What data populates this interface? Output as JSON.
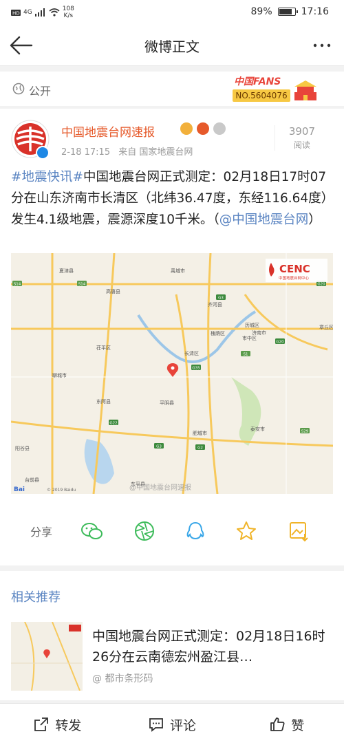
{
  "status": {
    "signal": "4G",
    "speed_value": "108",
    "speed_unit": "K/s",
    "battery": "89%",
    "battery_level": 0.89,
    "time": "17:16"
  },
  "nav": {
    "title": "微博正文"
  },
  "visibility": {
    "label": "公开"
  },
  "fans_badge": {
    "brand": "中国FANS",
    "number": "NO.5604076"
  },
  "post": {
    "author": "中国地震台网速报",
    "timestamp": "2-18 17:15",
    "source": "来自 国家地震台网",
    "read_count": "3907",
    "read_label": "阅读",
    "hashtag": "#地震快讯#",
    "body": "中国地震台网正式测定：02月18日17时07分在山东济南市长清区（北纬36.47度，东经116.64度）发生4.1级地震，震源深度10千米。（",
    "mention": "@中国地震台网",
    "closing": "）"
  },
  "map": {
    "logo": "CENC",
    "logo_sub": "中国地震台网中心",
    "copyright": "© 2019 Baidu",
    "baidu": "Bai",
    "watermark": "@中国地震台网速报",
    "places": [
      "夏津县",
      "高唐县",
      "禹城市",
      "齐河县",
      "历城区",
      "济南市",
      "章丘区",
      "槐荫区",
      "市中区",
      "茌平区",
      "长清区",
      "聊城市",
      "东阿县",
      "平阴县",
      "肥城市",
      "泰安市",
      "阳谷县",
      "台前县",
      "东平县"
    ],
    "roads": [
      "S14",
      "S14",
      "G3",
      "G35",
      "S1",
      "G20",
      "G22",
      "G2",
      "G3",
      "S29",
      "G20"
    ]
  },
  "share": {
    "label": "分享"
  },
  "related": {
    "title": "相关推荐",
    "item_title": "中国地震台网正式测定：02月18日16时26分在云南德宏州盈江县…",
    "item_source": "@ 都市条形码"
  },
  "bottombar": {
    "repost": "转发",
    "comment": "评论",
    "like": "赞"
  }
}
